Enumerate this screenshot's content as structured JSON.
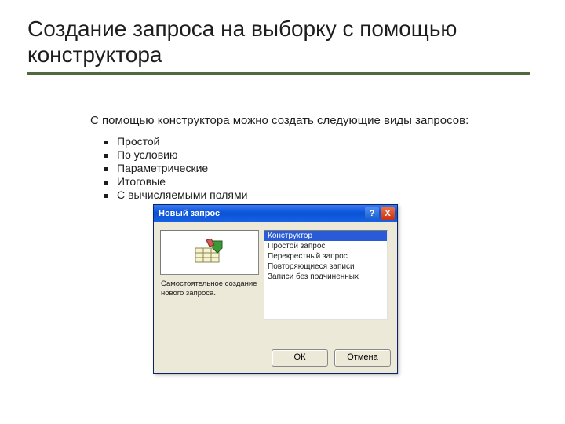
{
  "title": "Создание запроса на выборку с помощью конструктора",
  "intro": "С помощью конструктора можно создать следующие виды запросов:",
  "bullets": [
    "Простой",
    "По условию",
    "Параметрические",
    "Итоговые",
    "С вычисляемыми полями"
  ],
  "dialog": {
    "title": "Новый запрос",
    "help": "?",
    "close": "X",
    "left_text": "Самостоятельное создание нового запроса.",
    "options": [
      "Конструктор",
      "Простой запрос",
      "Перекрестный запрос",
      "Повторяющиеся записи",
      "Записи без подчиненных"
    ],
    "ok": "ОК",
    "cancel": "Отмена"
  }
}
